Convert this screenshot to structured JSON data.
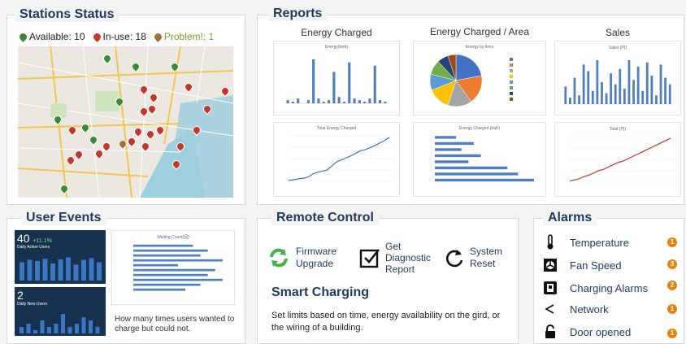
{
  "stations": {
    "title": "Stations Status",
    "available": "Available: 10",
    "in_use": "In-use: 18",
    "problem": "Problem!: 1",
    "colors": {
      "available": "#3b8a3b",
      "in_use": "#c0392b",
      "problem": "#a2713a"
    }
  },
  "reports": {
    "title": "Reports",
    "energy_charged": "Energy Charged",
    "energy_area": "Energy Charged / Area",
    "sales": "Sales",
    "mini_energy": "Energy(kwh)",
    "mini_pie": "Energy by Area",
    "mini_sales": "Sales (円)",
    "mini_total_energy": "Total Energy Charged",
    "mini_area_bar": "Energy Charged (kwh)",
    "mini_total_sales": "Total (円)"
  },
  "chart_data": [
    {
      "type": "bar",
      "title": "Energy(kwh)",
      "values": [
        2,
        1,
        3,
        0,
        2,
        28,
        3,
        1,
        2,
        20,
        4,
        1,
        26,
        3,
        2,
        1,
        3,
        24,
        2,
        1
      ]
    },
    {
      "type": "pie",
      "title": "Energy by Area",
      "values": [
        22,
        18,
        15,
        14,
        10,
        9,
        7,
        5
      ],
      "colors": [
        "#4472c4",
        "#ed7d31",
        "#a5a5a5",
        "#ffc000",
        "#5b9bd5",
        "#70ad47",
        "#264478",
        "#9e480e"
      ]
    },
    {
      "type": "bar",
      "title": "Sales (円)",
      "values": [
        8,
        3,
        12,
        4,
        18,
        15,
        6,
        20,
        10,
        5,
        14,
        9,
        16,
        7,
        20,
        11,
        17,
        6,
        19,
        13,
        4,
        18,
        12,
        9
      ]
    },
    {
      "type": "line",
      "title": "Total Energy Charged",
      "values": [
        2,
        3,
        5,
        6,
        8,
        14,
        18,
        20,
        22,
        30,
        38,
        42,
        46,
        50,
        55,
        60,
        62,
        66,
        70,
        75,
        80,
        86
      ]
    },
    {
      "type": "bar",
      "title": "Energy Charged (kwh)",
      "values": [
        120,
        220,
        150,
        260,
        190,
        410,
        470,
        560
      ]
    },
    {
      "type": "line",
      "title": "Total (円)",
      "values": [
        1,
        2,
        3,
        5,
        6,
        8,
        10,
        11,
        13,
        15,
        17,
        18,
        20,
        22,
        24,
        26,
        28,
        30,
        32,
        34,
        36,
        38
      ]
    }
  ],
  "user_events": {
    "title": "User Events",
    "dau_value": "40",
    "dau_change": "+11.1%",
    "dau_label": "Daily Active Users",
    "dnu_value": "2",
    "dnu_label": "Daily New Users",
    "waiting_title": "Waiting Count(回)",
    "caption": "How many times users wanted to charge but could not."
  },
  "remote_control": {
    "title": "Remote Control",
    "firmware": "Firmware Upgrade",
    "diagnostic": "Get Diagnostic Report",
    "reset": "System Reset",
    "smart_title": "Smart Charging",
    "smart_desc": "Set limits based on time, energy availability on the gird,  or the wiring of a building."
  },
  "alarms": {
    "title": "Alarms",
    "items": [
      {
        "label": "Temperature",
        "count": "1"
      },
      {
        "label": "Fan Speed",
        "count": "3"
      },
      {
        "label": "Charging Alarms",
        "count": "2"
      },
      {
        "label": "Network",
        "count": "1"
      },
      {
        "label": "Door opened",
        "count": "1"
      }
    ]
  }
}
